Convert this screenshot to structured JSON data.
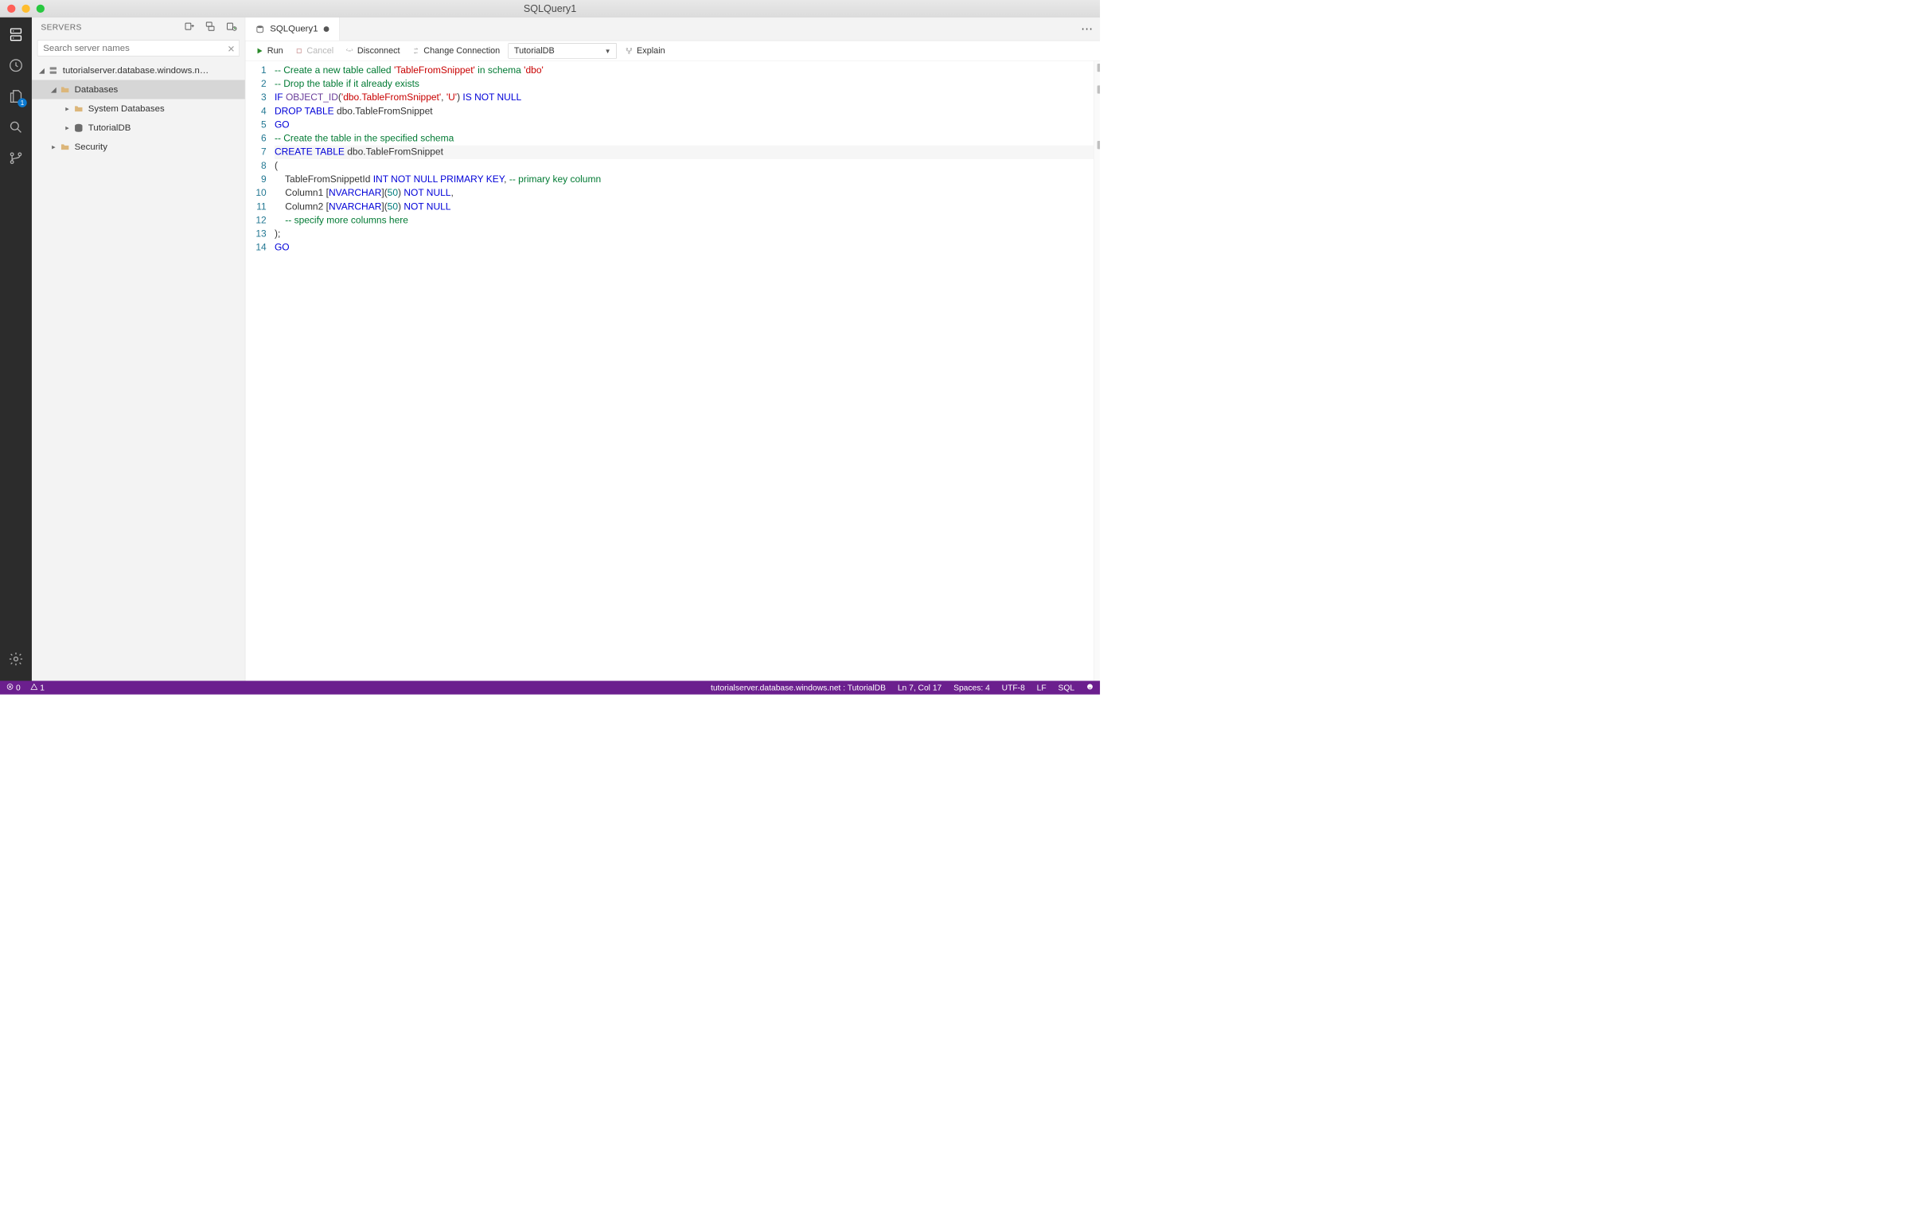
{
  "window": {
    "title": "SQLQuery1"
  },
  "activity": {
    "file_badge": "1"
  },
  "sidebar": {
    "title": "SERVERS",
    "search_placeholder": "Search server names",
    "nodes": {
      "server": "tutorialserver.database.windows.n…",
      "databases": "Databases",
      "sysdb": "System Databases",
      "tutorialdb": "TutorialDB",
      "security": "Security"
    }
  },
  "tab": {
    "label": "SQLQuery1"
  },
  "toolbar": {
    "run": "Run",
    "cancel": "Cancel",
    "disconnect": "Disconnect",
    "change_conn": "Change Connection",
    "selected_db": "TutorialDB",
    "explain": "Explain"
  },
  "code": {
    "lines": [
      "-- Create a new table called 'TableFromSnippet' in schema 'dbo'",
      "-- Drop the table if it already exists",
      "IF OBJECT_ID('dbo.TableFromSnippet', 'U') IS NOT NULL",
      "DROP TABLE dbo.TableFromSnippet",
      "GO",
      "-- Create the table in the specified schema",
      "CREATE TABLE dbo.TableFromSnippet",
      "(",
      "    TableFromSnippetId INT NOT NULL PRIMARY KEY, -- primary key column",
      "    Column1 [NVARCHAR](50) NOT NULL,",
      "    Column2 [NVARCHAR](50) NOT NULL",
      "    -- specify more columns here",
      ");",
      "GO"
    ],
    "line_count": 14,
    "current_line": 7
  },
  "status": {
    "errors": "0",
    "warnings": "1",
    "connection": "tutorialserver.database.windows.net : TutorialDB",
    "position": "Ln 7, Col 17",
    "spaces": "Spaces: 4",
    "encoding": "UTF-8",
    "eol": "LF",
    "language": "SQL"
  }
}
